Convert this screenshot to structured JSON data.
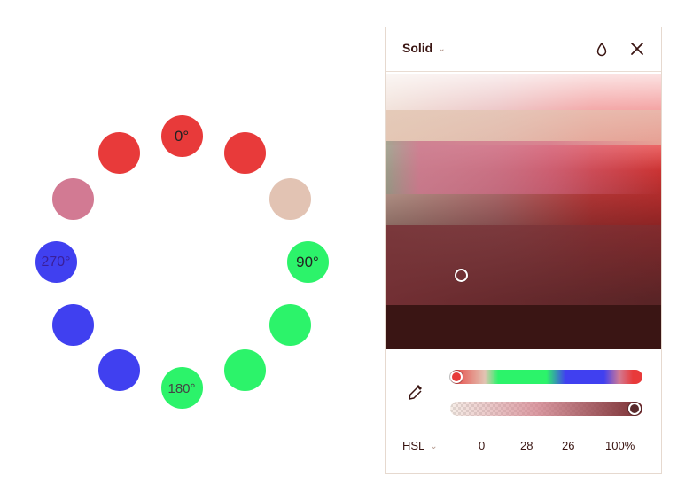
{
  "wheel": {
    "swatches": [
      {
        "angle": 0,
        "label": "0°",
        "color": "#e83a3a"
      },
      {
        "angle": 30,
        "label": "",
        "color": "#e83a3a"
      },
      {
        "angle": 60,
        "label": "",
        "color": "#e2c3b3"
      },
      {
        "angle": 90,
        "label": "90°",
        "color": "#2cf36a"
      },
      {
        "angle": 120,
        "label": "",
        "color": "#2cf36a"
      },
      {
        "angle": 150,
        "label": "",
        "color": "#2cf36a"
      },
      {
        "angle": 180,
        "label": "180°",
        "color": "#2cf36a"
      },
      {
        "angle": 210,
        "label": "",
        "color": "#4040f0"
      },
      {
        "angle": 240,
        "label": "",
        "color": "#4040f0"
      },
      {
        "angle": 270,
        "label": "270°",
        "color": "#4040f0"
      },
      {
        "angle": 300,
        "label": "",
        "color": "#d27a93"
      },
      {
        "angle": 330,
        "label": "",
        "color": "#e83a3a"
      }
    ]
  },
  "panel": {
    "type_label": "Solid",
    "mode_label": "HSL",
    "values": {
      "h": "0",
      "s": "28",
      "l": "26",
      "alpha": "100%"
    }
  }
}
